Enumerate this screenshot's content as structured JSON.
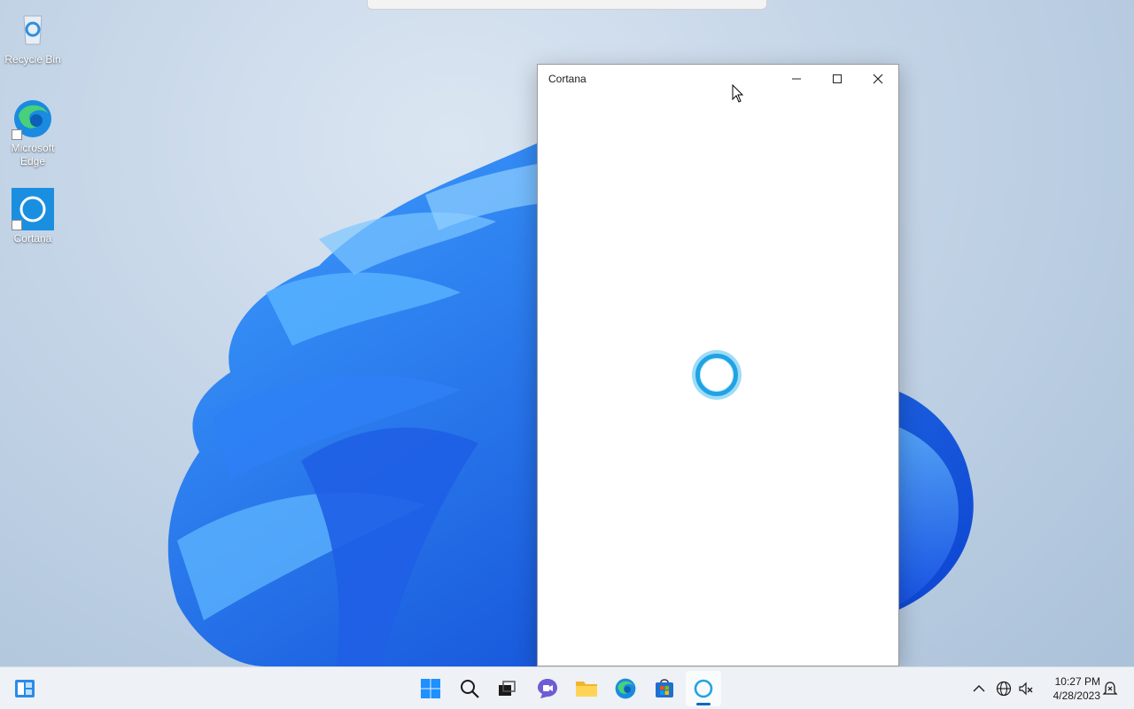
{
  "desktop": {
    "icons": [
      {
        "label": "Recycle Bin",
        "icon": "recycle-bin-icon"
      },
      {
        "label": "Microsoft Edge",
        "icon": "edge-icon"
      },
      {
        "label": "Cortana",
        "icon": "cortana-icon"
      }
    ]
  },
  "window": {
    "title": "Cortana",
    "controls": {
      "minimize": "minimize-icon",
      "maximize": "maximize-icon",
      "close": "close-icon"
    },
    "status": "loading"
  },
  "taskbar": {
    "left": [
      {
        "name": "widgets",
        "icon": "widgets-icon"
      }
    ],
    "apps": [
      {
        "name": "start",
        "icon": "windows-start-icon"
      },
      {
        "name": "search",
        "icon": "search-icon"
      },
      {
        "name": "task-view",
        "icon": "task-view-icon"
      },
      {
        "name": "chat",
        "icon": "teams-chat-icon"
      },
      {
        "name": "file-explorer",
        "icon": "folder-icon"
      },
      {
        "name": "edge",
        "icon": "edge-icon"
      },
      {
        "name": "store",
        "icon": "store-icon"
      },
      {
        "name": "cortana",
        "icon": "cortana-icon",
        "active": true
      }
    ],
    "tray": [
      {
        "name": "show-hidden",
        "icon": "chevron-up-icon"
      },
      {
        "name": "network",
        "icon": "globe-icon"
      },
      {
        "name": "volume",
        "icon": "speaker-muted-icon"
      }
    ],
    "time": "10:27 PM",
    "date": "4/28/2023",
    "notification_icon": "notification-icon"
  },
  "colors": {
    "accent": "#0067c0",
    "cortana": "#1fa3e6",
    "bloom": "#1e6cf0"
  }
}
